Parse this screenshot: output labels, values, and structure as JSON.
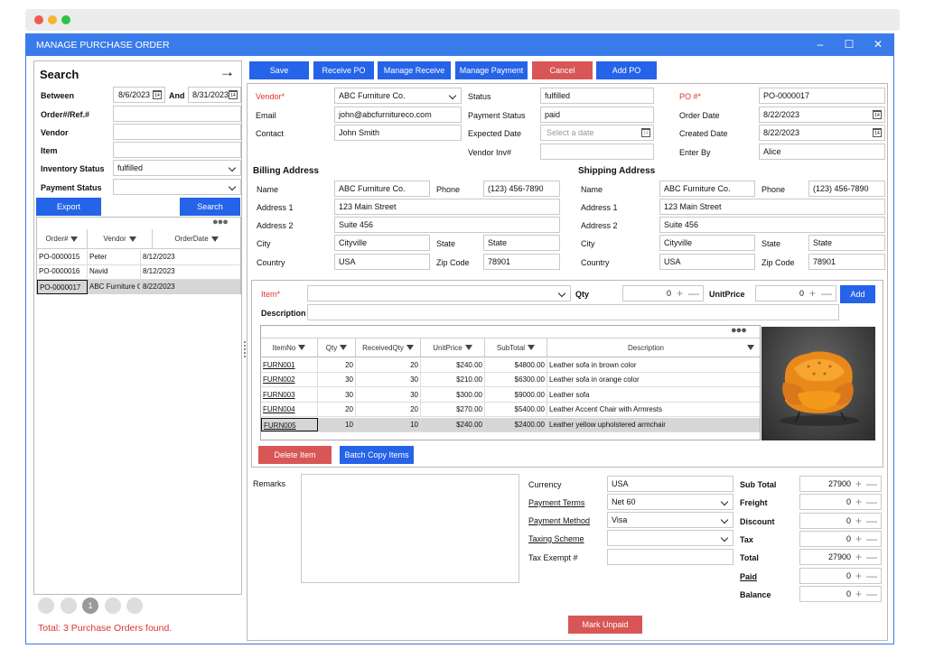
{
  "window": {
    "title": "MANAGE PURCHASE ORDER"
  },
  "search": {
    "title": "Search",
    "between_label": "Between",
    "date_from": "8/6/2023",
    "and_label": "And",
    "date_to": "8/31/2023",
    "order_label": "Order#/Ref.#",
    "vendor_label": "Vendor",
    "item_label": "Item",
    "inventory_status_label": "Inventory Status",
    "inventory_status_value": "fulfilled",
    "payment_status_label": "Payment Status",
    "export_label": "Export",
    "search_label": "Search",
    "calendar_glyph": "14"
  },
  "order_list": {
    "headers": [
      "Order#",
      "Vendor",
      "OrderDate"
    ],
    "rows": [
      [
        "PO-0000015",
        "Peter",
        "8/12/2023"
      ],
      [
        "PO-0000016",
        "Navid",
        "8/12/2023"
      ],
      [
        "PO-0000017",
        "ABC Furniture Co.",
        "8/22/2023"
      ]
    ],
    "page": "1",
    "total_text": "Total: 3 Purchase Orders found."
  },
  "toolbar": {
    "save": "Save",
    "receive_po": "Receive PO",
    "manage_receive": "Manage Receive",
    "manage_payment": "Manage Payment",
    "cancel": "Cancel",
    "add_po": "Add PO"
  },
  "header": {
    "vendor_label": "Vendor*",
    "vendor_value": "ABC Furniture Co.",
    "email_label": "Email",
    "email_value": "john@abcfurnitureco.com",
    "contact_label": "Contact",
    "contact_value": "John Smith",
    "status_label": "Status",
    "status_value": "fulfilled",
    "payment_status_label": "Payment Status",
    "payment_status_value": "paid",
    "expected_date_label": "Expected Date",
    "expected_date_placeholder": "Select a date",
    "vendor_inv_label": "Vendor Inv#",
    "po_label": "PO #*",
    "po_value": "PO-0000017",
    "order_date_label": "Order Date",
    "order_date_value": "8/22/2023",
    "created_date_label": "Created Date",
    "created_date_value": "8/22/2023",
    "enter_by_label": "Enter By",
    "enter_by_value": "Alice"
  },
  "billing": {
    "title": "Billing Address",
    "name_label": "Name",
    "name": "ABC Furniture Co.",
    "phone_label": "Phone",
    "phone": "(123) 456-7890",
    "addr1_label": "Address 1",
    "addr1": "123 Main Street",
    "addr2_label": "Address 2",
    "addr2": "Suite 456",
    "city_label": "City",
    "city": "Cityville",
    "state_label": "State",
    "state": "State",
    "country_label": "Country",
    "country": "USA",
    "zip_label": "Zip Code",
    "zip": "78901"
  },
  "shipping": {
    "title": "Shipping Address",
    "name_label": "Name",
    "name": "ABC Furniture Co.",
    "phone_label": "Phone",
    "phone": "(123) 456-7890",
    "addr1_label": "Address 1",
    "addr1": "123 Main Street",
    "addr2_label": "Address 2",
    "addr2": "Suite 456",
    "city_label": "City",
    "city": "Cityville",
    "state_label": "State",
    "state": "State",
    "country_label": "Country",
    "country": "USA",
    "zip_label": "Zip Code",
    "zip": "78901"
  },
  "item_entry": {
    "item_label": "Item*",
    "qty_label": "Qty",
    "qty_value": "0",
    "unit_price_label": "UnitPrice",
    "unit_price_value": "0",
    "add_label": "Add",
    "description_label": "Description",
    "plus": "+",
    "minus": "—"
  },
  "items_table": {
    "headers": [
      "ItemNo",
      "Qty",
      "ReceivedQty",
      "UnitPrice",
      "SubTotal",
      "Description"
    ],
    "rows": [
      [
        "FURN001",
        "20",
        "20",
        "$240.00",
        "$4800.00",
        "Leather sofa in brown color"
      ],
      [
        "FURN002",
        "30",
        "30",
        "$210.00",
        "$6300.00",
        "Leather sofa in orange color"
      ],
      [
        "FURN003",
        "30",
        "30",
        "$300.00",
        "$9000.00",
        "Leather sofa"
      ],
      [
        "FURN004",
        "20",
        "20",
        "$270.00",
        "$5400.00",
        "Leather Accent Chair with Armrests"
      ],
      [
        "FURN005",
        "10",
        "10",
        "$240.00",
        "$2400.00",
        "Leather yellow upholstered armchair"
      ]
    ],
    "delete_label": "Delete Item",
    "batch_copy_label": "Batch Copy Items"
  },
  "footer": {
    "remarks_label": "Remarks",
    "currency_label": "Currency",
    "currency_value": "USA",
    "payment_terms_label": "Payment Terms",
    "payment_terms_value": "Net 60",
    "payment_method_label": "Payment Method",
    "payment_method_value": "Visa",
    "taxing_scheme_label": "Taxing Scheme",
    "tax_exempt_label": "Tax Exempt #",
    "subtotal_label": "Sub Total",
    "subtotal_value": "27900",
    "freight_label": "Freight",
    "freight_value": "0",
    "discount_label": "Discount",
    "discount_value": "0",
    "tax_label": "Tax",
    "tax_value": "0",
    "total_label": "Total",
    "total_value": "27900",
    "paid_label": "Paid",
    "paid_value": "0",
    "balance_label": "Balance",
    "balance_value": "0",
    "mark_unpaid_label": "Mark Unpaid"
  },
  "colors": {
    "accent": "#2563e8",
    "danger": "#d85656",
    "title_bar": "#3a7bea",
    "chair": "#f39a1c"
  },
  "icons": {
    "arrow": "arrow-right-icon",
    "filter": "filter-icon",
    "calendar": "calendar-icon",
    "more": "more-dots-icon"
  }
}
